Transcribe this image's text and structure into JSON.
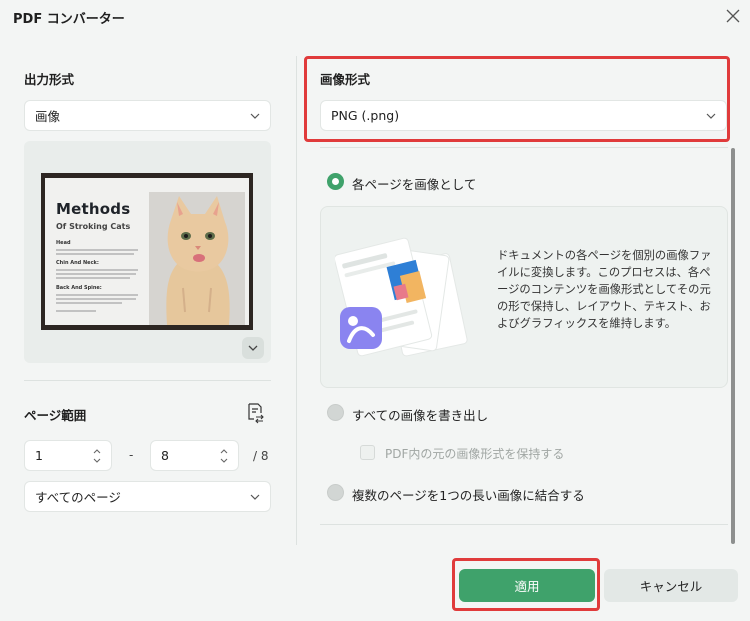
{
  "window": {
    "title": "PDF コンバーター"
  },
  "output_format": {
    "label": "出力形式",
    "selected": "画像"
  },
  "preview_doc": {
    "title": "Methods",
    "subtitle": "Of Stroking Cats",
    "sections": [
      "Head",
      "Chin And Neck:",
      "Back And Spine:"
    ]
  },
  "page_range": {
    "label": "ページ範囲",
    "from": "1",
    "dash": "-",
    "to": "8",
    "total": "/ 8",
    "scope": "すべてのページ"
  },
  "image_format": {
    "label": "画像形式",
    "selected": "PNG (.png)"
  },
  "options": [
    {
      "label": "各ページを画像として",
      "selected": true
    },
    {
      "label": "すべての画像を書き出し",
      "selected": false
    },
    {
      "label": "複数のページを1つの長い画像に結合する",
      "selected": false
    }
  ],
  "info_text": "ドキュメントの各ページを個別の画像ファイルに変換します。このプロセスは、各ページのコンテンツを画像形式としてその元の形で保持し、レイアウト、テキスト、およびグラフィックスを維持します。",
  "keep_original_format": {
    "label": "PDF内の元の画像形式を保持する",
    "checked": false
  },
  "buttons": {
    "apply": "適用",
    "cancel": "キャンセル"
  },
  "colors": {
    "accent": "#3fa26b",
    "highlight": "#e03b3b"
  }
}
